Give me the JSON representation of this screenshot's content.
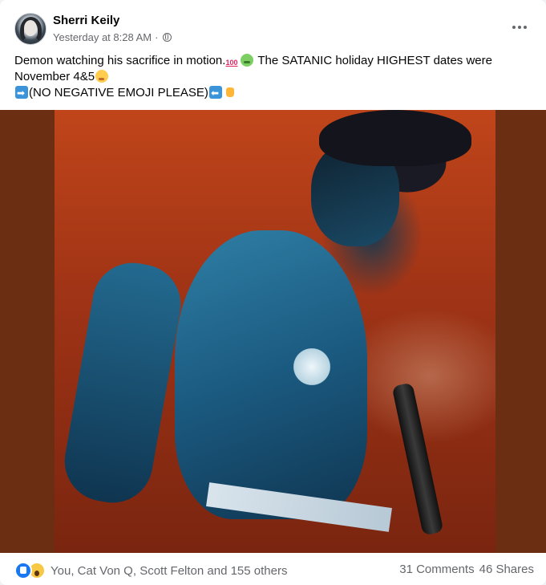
{
  "post": {
    "author": "Sherri Keily",
    "timestamp": "Yesterday at 8:28 AM",
    "separator": "·",
    "privacy_icon": "globe-icon",
    "more_icon": "more-options-icon",
    "text": {
      "line1_a": "Demon watching his sacrifice in motion.",
      "line1_b": " The SATANIC holiday HIGHEST dates were",
      "line2": "November 4&5",
      "line3": "(NO NEGATIVE EMOJI PLEASE)"
    },
    "emojis": [
      "hundred-points",
      "nauseated-face",
      "drooling-face",
      "right-arrow",
      "left-arrow",
      "thumbs-up"
    ]
  },
  "photo": {
    "frame_color": "#6b2e12"
  },
  "footer": {
    "reaction_icons": [
      "like-icon",
      "wow-icon"
    ],
    "reaction_names": "You, Cat Von Q, Scott Felton and 155 others",
    "comments": "31 Comments",
    "shares": "46 Shares"
  }
}
